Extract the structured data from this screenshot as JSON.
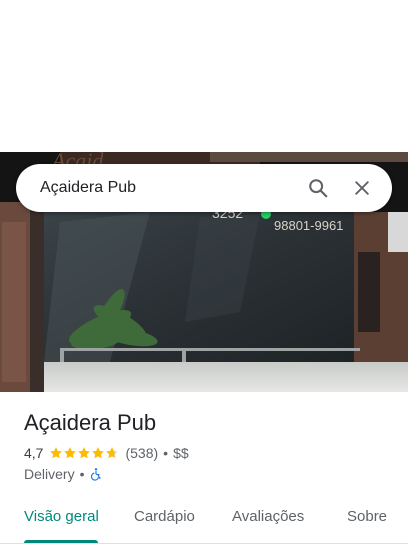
{
  "search": {
    "query": "Açaidera Pub"
  },
  "place": {
    "name": "Açaidera Pub",
    "rating": "4,7",
    "stars": 4.7,
    "reviews": "(538)",
    "price": "$$",
    "category": "Delivery",
    "dot": "•"
  },
  "photo_sign": {
    "phone_part1": "3252",
    "phone_part2": "98801-9961",
    "brand": "Açaidera"
  },
  "tabs": [
    {
      "label": "Visão geral",
      "active": true
    },
    {
      "label": "Cardápio",
      "active": false
    },
    {
      "label": "Avaliações",
      "active": false
    },
    {
      "label": "Sobre",
      "active": false
    }
  ],
  "colors": {
    "accent": "#00897b",
    "star": "#fbbc04",
    "accessibility": "#1a73e8"
  },
  "icons": [
    "search-icon",
    "close-icon",
    "star-icon",
    "wheelchair-icon"
  ]
}
